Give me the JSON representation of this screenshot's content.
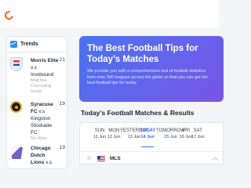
{
  "trends": {
    "title": "Trends",
    "items": [
      {
        "team": "Morris Elite",
        "vs": "v.s",
        "opponent": "Ironbound",
        "status": "Matches Conceding Goals",
        "count": "21"
      },
      {
        "team": "Syracuse FC",
        "vs": "v.s",
        "opponent": "Kingston Stockade FC",
        "status": "No Wins",
        "count": "19"
      },
      {
        "team": "Chicago Dutch Lions",
        "vs": "v.s",
        "opponent": "",
        "status": "",
        "count": "19"
      }
    ]
  },
  "hero": {
    "title": "The Best Football Tips for Today’s Matches",
    "description": "We provide you with a comprehensive tool of football statistics from over 300 leagues across the globe so that you can get the best football tips for today."
  },
  "section": {
    "title": "Today’s Football Matches & Results"
  },
  "days": [
    {
      "name": "SUN",
      "date": "11 Jun"
    },
    {
      "name": "MON",
      "date": "12 Jun"
    },
    {
      "name": "YESTERDAY",
      "date": "13 Jun"
    },
    {
      "name": "TODAY",
      "date": "14 Jun",
      "active": true
    },
    {
      "name": "TOMORROW",
      "date": "15 Jun"
    },
    {
      "name": "FRI",
      "date": "16 Jun"
    },
    {
      "name": "SAT",
      "date": "17 Jun"
    }
  ],
  "league": {
    "name": "MLS",
    "icon": "star-icon",
    "flag": "us-flag-icon",
    "toggle_icon": "chevron-up-icon"
  }
}
